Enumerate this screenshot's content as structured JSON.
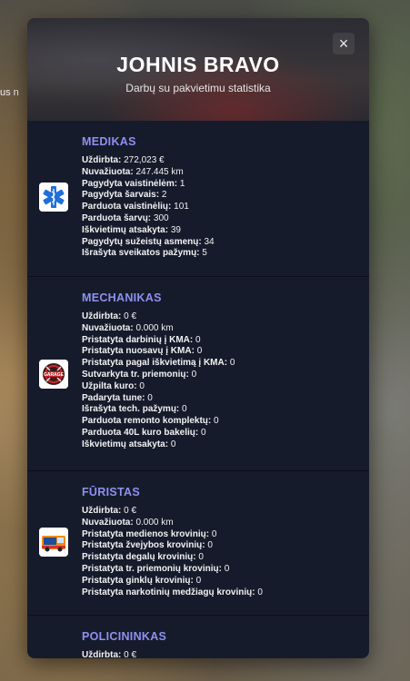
{
  "background": {
    "partial_text": "us n"
  },
  "header": {
    "title": "JOHNIS BRAVO",
    "subtitle": "Darbų su pakvietimu statistika",
    "close_label": "×"
  },
  "sections": [
    {
      "name": "MEDIKAS",
      "icon": "star-of-life-icon",
      "stats": [
        {
          "label": "Uždirbta:",
          "value": "272,023 €"
        },
        {
          "label": "Nuvažiuota:",
          "value": "247.445 km"
        },
        {
          "label": "Pagydyta vaistinėlėm:",
          "value": "1"
        },
        {
          "label": "Pagydyta šarvais:",
          "value": "2"
        },
        {
          "label": "Parduota vaistinėlių:",
          "value": "101"
        },
        {
          "label": "Parduota šarvų:",
          "value": "300"
        },
        {
          "label": "Iškvietimų atsakyta:",
          "value": "39"
        },
        {
          "label": "Pagydytų sužeistų asmenų:",
          "value": "34"
        },
        {
          "label": "Išrašyta sveikatos pažymų:",
          "value": "5"
        }
      ]
    },
    {
      "name": "MECHANIKAS",
      "icon": "garage-logo-icon",
      "stats": [
        {
          "label": "Uždirbta:",
          "value": "0 €"
        },
        {
          "label": "Nuvažiuota:",
          "value": "0.000 km"
        },
        {
          "label": "Pristatyta darbinių į KMA:",
          "value": "0"
        },
        {
          "label": "Pristatyta nuosavų į KMA:",
          "value": "0"
        },
        {
          "label": "Pristatyta pagal iškvietimą į KMA:",
          "value": "0"
        },
        {
          "label": "Sutvarkyta tr. priemonių:",
          "value": "0"
        },
        {
          "label": "Užpilta kuro:",
          "value": "0"
        },
        {
          "label": "Padaryta tune:",
          "value": "0"
        },
        {
          "label": "Išrašyta tech. pažymų:",
          "value": "0"
        },
        {
          "label": "Parduota remonto komplektų:",
          "value": "0"
        },
        {
          "label": "Parduota 40L kuro bakelių:",
          "value": "0"
        },
        {
          "label": "Iškvietimų atsakyta:",
          "value": "0"
        }
      ]
    },
    {
      "name": "FŪRISTAS",
      "icon": "truck-icon",
      "stats": [
        {
          "label": "Uždirbta:",
          "value": "0 €"
        },
        {
          "label": "Nuvažiuota:",
          "value": "0.000 km"
        },
        {
          "label": "Pristatyta medienos krovinių:",
          "value": "0"
        },
        {
          "label": "Pristatyta žvejybos krovinių:",
          "value": "0"
        },
        {
          "label": "Pristatyta degalų krovinių:",
          "value": "0"
        },
        {
          "label": "Pristatyta tr. priemonių krovinių:",
          "value": "0"
        },
        {
          "label": "Pristatyta ginklų krovinių:",
          "value": "0"
        },
        {
          "label": "Pristatyta narkotinių medžiagų krovinių:",
          "value": "0"
        }
      ]
    },
    {
      "name": "POLICININKAS",
      "icon": "police-icon",
      "stats": [
        {
          "label": "Uždirbta:",
          "value": "0 €"
        }
      ]
    }
  ],
  "colors": {
    "panel": "#161b2b",
    "section_title": "#8f90f0",
    "text": "#f2f2f2"
  }
}
